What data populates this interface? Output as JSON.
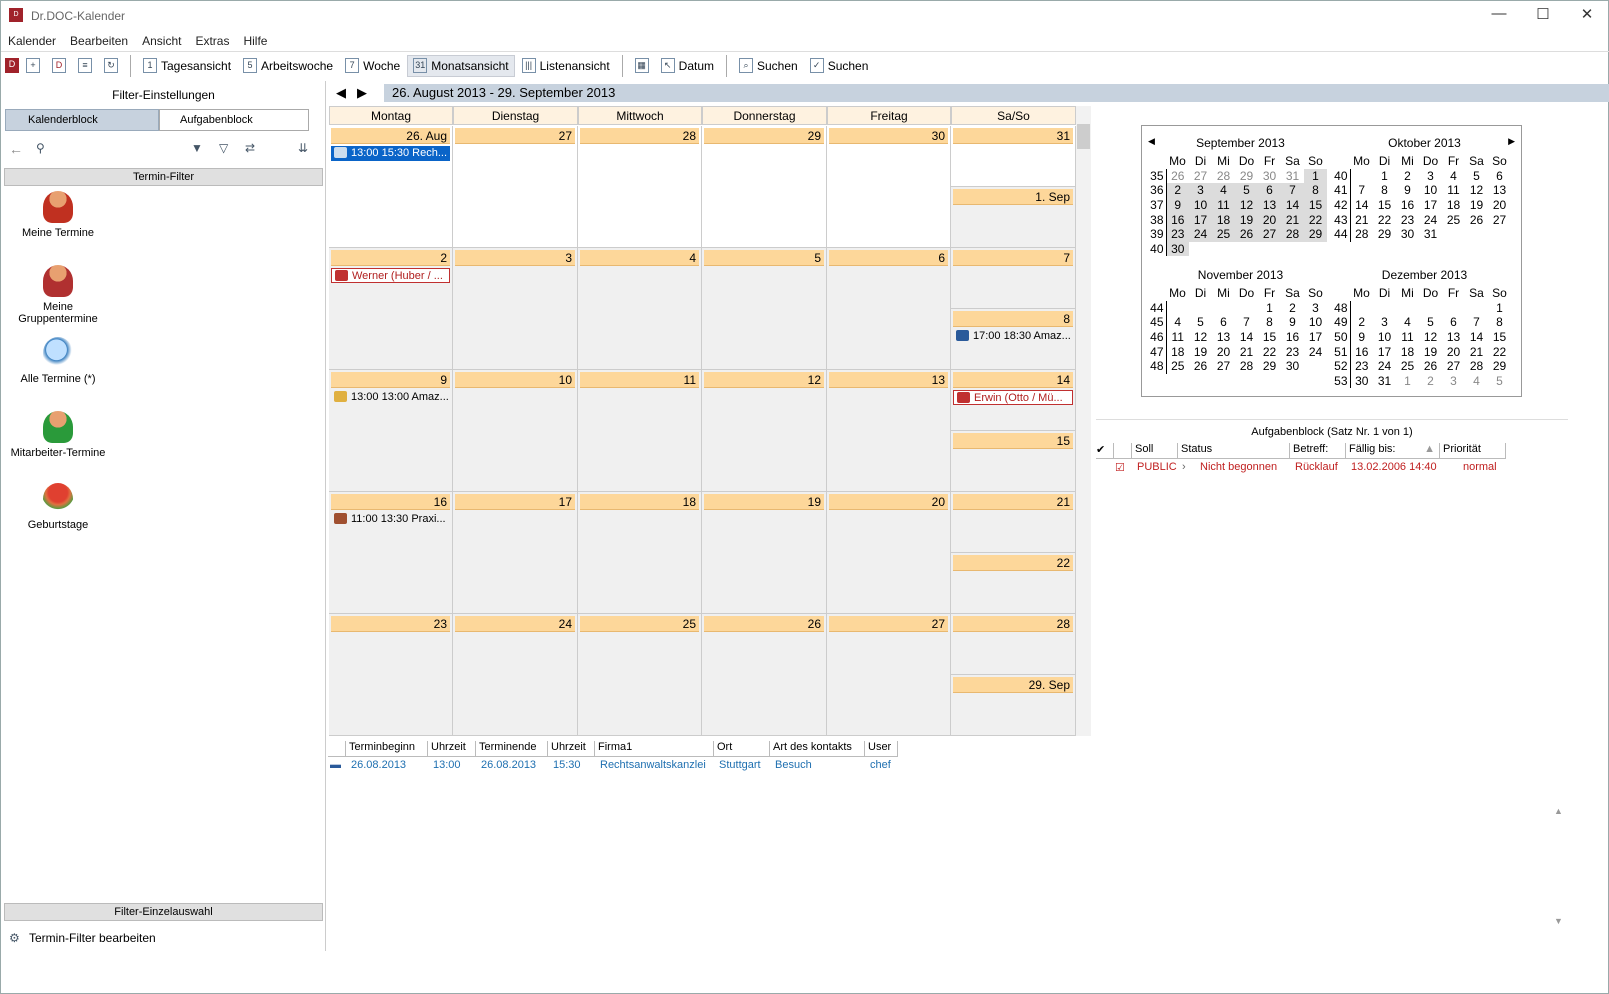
{
  "window": {
    "title": "Dr.DOC-Kalender",
    "app_icon": "Dr DOC"
  },
  "menu": [
    "Kalender",
    "Bearbeiten",
    "Ansicht",
    "Extras",
    "Hilfe"
  ],
  "toolbar": {
    "views": [
      {
        "label": "Tagesansicht",
        "icon": "1"
      },
      {
        "label": "Arbeitswoche",
        "icon": "5"
      },
      {
        "label": "Woche",
        "icon": "7"
      },
      {
        "label": "Monatsansicht",
        "icon": "31",
        "active": true
      },
      {
        "label": "Listenansicht",
        "icon": "|||"
      }
    ],
    "datum": "Datum",
    "search1": "Suchen",
    "search2": "Suchen"
  },
  "left": {
    "title": "Filter-Einstellungen",
    "tabs": [
      "Kalenderblock",
      "Aufgabenblock"
    ],
    "section": "Termin-Filter",
    "filters": [
      "Meine Termine",
      "Meine Gruppentermine",
      "Alle Termine (*)",
      "Mitarbeiter-Termine",
      "Geburtstage"
    ],
    "bottom_section": "Filter-Einzelauswahl",
    "edit_link": "Termin-Filter bearbeiten"
  },
  "calendar": {
    "range": "26. August 2013 - 29. September 2013",
    "day_headers": [
      "Montag",
      "Dienstag",
      "Mittwoch",
      "Donnerstag",
      "Freitag",
      "Sa/So"
    ],
    "weeks": [
      {
        "days": [
          "26. Aug",
          "27",
          "28",
          "29",
          "30",
          "31",
          "1. Sep"
        ],
        "august": [
          true,
          true,
          true,
          true,
          true,
          true,
          false
        ]
      },
      {
        "days": [
          "2",
          "3",
          "4",
          "5",
          "6",
          "7",
          "8"
        ]
      },
      {
        "days": [
          "9",
          "10",
          "11",
          "12",
          "13",
          "14",
          "15"
        ]
      },
      {
        "days": [
          "16",
          "17",
          "18",
          "19",
          "20",
          "21",
          "22"
        ]
      },
      {
        "days": [
          "23",
          "24",
          "25",
          "26",
          "27",
          "28",
          "29. Sep"
        ]
      }
    ],
    "events": [
      {
        "week": 0,
        "day": 0,
        "text": "13:00 15:30 Rech...",
        "type": "selected",
        "color": "#0a64c8"
      },
      {
        "week": 1,
        "day": 0,
        "text": "Werner (Huber / ...",
        "type": "birthday",
        "color": "#c03030"
      },
      {
        "week": 1,
        "day": 6,
        "text": "17:00 18:30 Amaz...",
        "type": "car",
        "color": "#2a5a9a"
      },
      {
        "week": 2,
        "day": 0,
        "text": "13:00 13:00 Amaz...",
        "type": "mail",
        "color": "#e0b040"
      },
      {
        "week": 2,
        "day": 5,
        "text": "Erwin (Otto / Mü...",
        "type": "birthday",
        "color": "#c03030"
      },
      {
        "week": 3,
        "day": 0,
        "text": "11:00 13:30 Praxi...",
        "type": "house",
        "color": "#a05030"
      }
    ]
  },
  "mini_calendars": {
    "weekday_headers": [
      "Mo",
      "Di",
      "Mi",
      "Do",
      "Fr",
      "Sa",
      "So"
    ],
    "months": [
      {
        "title": "September 2013",
        "rows": [
          [
            "35",
            "26",
            "27",
            "28",
            "29",
            "30",
            "31",
            "1"
          ],
          [
            "36",
            "2",
            "3",
            "4",
            "5",
            "6",
            "7",
            "8"
          ],
          [
            "37",
            "9",
            "10",
            "11",
            "12",
            "13",
            "14",
            "15"
          ],
          [
            "38",
            "16",
            "17",
            "18",
            "19",
            "20",
            "21",
            "22"
          ],
          [
            "39",
            "23",
            "24",
            "25",
            "26",
            "27",
            "28",
            "29"
          ],
          [
            "40",
            "30",
            "",
            "",
            "",
            "",
            "",
            ""
          ]
        ],
        "other": [
          [
            1,
            2,
            3,
            4,
            5,
            6
          ]
        ]
      },
      {
        "title": "Oktober 2013",
        "rows": [
          [
            "40",
            "",
            "1",
            "2",
            "3",
            "4",
            "5",
            "6"
          ],
          [
            "41",
            "7",
            "8",
            "9",
            "10",
            "11",
            "12",
            "13"
          ],
          [
            "42",
            "14",
            "15",
            "16",
            "17",
            "18",
            "19",
            "20"
          ],
          [
            "43",
            "21",
            "22",
            "23",
            "24",
            "25",
            "26",
            "27"
          ],
          [
            "44",
            "28",
            "29",
            "30",
            "31",
            "",
            "",
            ""
          ]
        ]
      },
      {
        "title": "November 2013",
        "rows": [
          [
            "44",
            "",
            "",
            "",
            "",
            "1",
            "2",
            "3"
          ],
          [
            "45",
            "4",
            "5",
            "6",
            "7",
            "8",
            "9",
            "10"
          ],
          [
            "46",
            "11",
            "12",
            "13",
            "14",
            "15",
            "16",
            "17"
          ],
          [
            "47",
            "18",
            "19",
            "20",
            "21",
            "22",
            "23",
            "24"
          ],
          [
            "48",
            "25",
            "26",
            "27",
            "28",
            "29",
            "30",
            ""
          ]
        ]
      },
      {
        "title": "Dezember 2013",
        "rows": [
          [
            "48",
            "",
            "",
            "",
            "",
            "",
            "",
            "1"
          ],
          [
            "49",
            "2",
            "3",
            "4",
            "5",
            "6",
            "7",
            "8"
          ],
          [
            "50",
            "9",
            "10",
            "11",
            "12",
            "13",
            "14",
            "15"
          ],
          [
            "51",
            "16",
            "17",
            "18",
            "19",
            "20",
            "21",
            "22"
          ],
          [
            "52",
            "23",
            "24",
            "25",
            "26",
            "27",
            "28",
            "29"
          ],
          [
            "53",
            "30",
            "31",
            "1",
            "2",
            "3",
            "4",
            "5"
          ]
        ]
      }
    ]
  },
  "tasks": {
    "title": "Aufgabenblock (Satz Nr. 1 von 1)",
    "columns": [
      "Soll",
      "Status",
      "Betreff:",
      "Fällig bis:",
      "Priorität"
    ],
    "rows": [
      {
        "soll": "PUBLIC",
        "status": "Nicht begonnen",
        "betreff": "Rücklauf",
        "faellig": "13.02.2006 14:40",
        "prioritaet": "normal"
      }
    ]
  },
  "appointments": {
    "columns": [
      "Terminbeginn",
      "Uhrzeit",
      "Terminende",
      "Uhrzeit",
      "Firma1",
      "Ort",
      "Art des kontakts",
      "User"
    ],
    "rows": [
      [
        "26.08.2013",
        "13:00",
        "26.08.2013",
        "15:30",
        "Rechtsanwaltskanzlei",
        "Stuttgart",
        "Besuch",
        "chef"
      ]
    ]
  }
}
